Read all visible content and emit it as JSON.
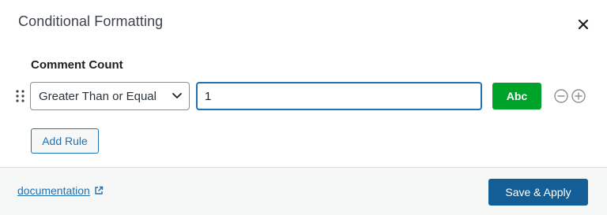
{
  "dialog": {
    "title": "Conditional Formatting",
    "close_icon": "close-icon"
  },
  "field": {
    "label": "Comment Count"
  },
  "rule": {
    "operator": "Greater Than or Equal",
    "value": "1",
    "style_label": "Abc",
    "drag_icon": "drag-handle-icon",
    "remove_icon": "minus-circle-icon",
    "add_icon": "plus-circle-icon"
  },
  "actions": {
    "add_rule_label": "Add Rule",
    "documentation_label": "documentation",
    "external_icon": "external-link-icon",
    "save_label": "Save & Apply"
  },
  "colors": {
    "primary": "#135e96",
    "link": "#2271b1",
    "style_green": "#00a32a",
    "footer_bg": "#f6f7f7"
  }
}
